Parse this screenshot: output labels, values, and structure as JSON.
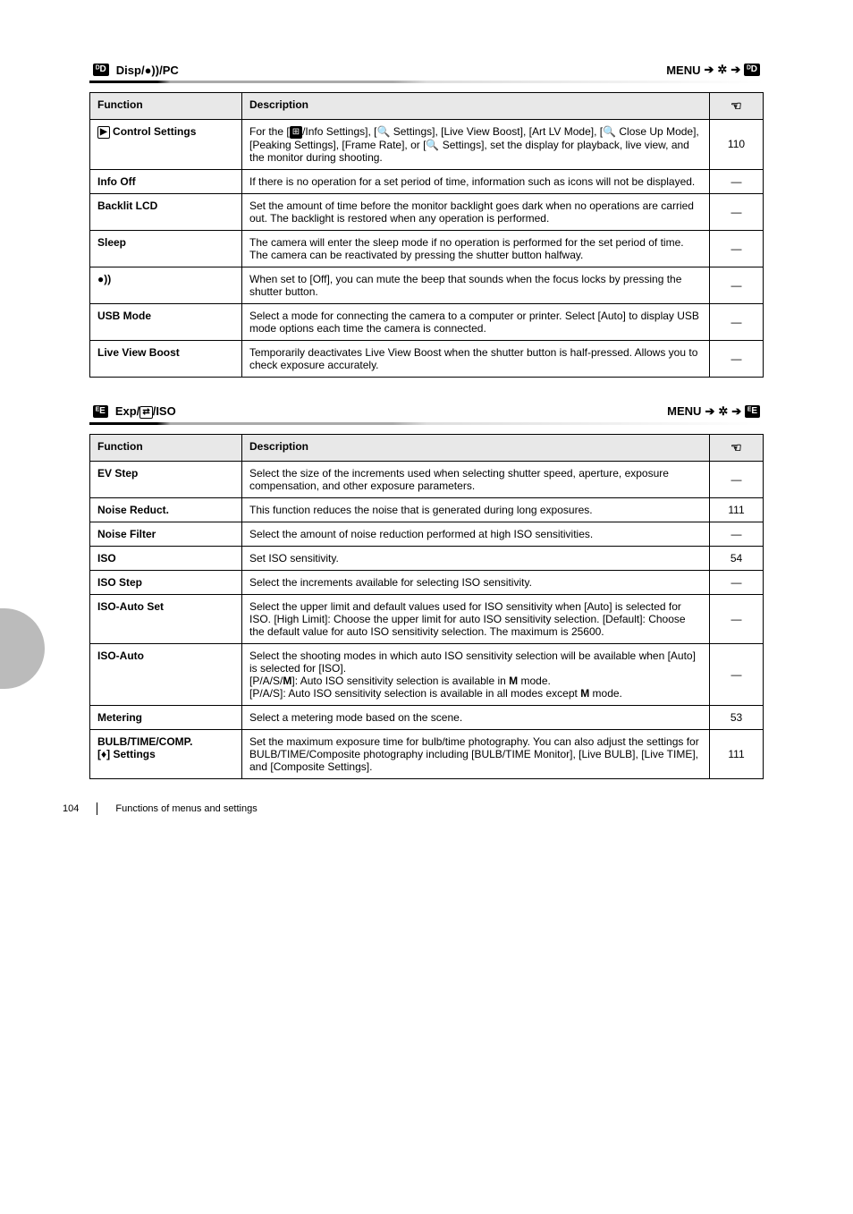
{
  "page": {
    "number": "104",
    "footer_text": "Functions of menus and settings"
  },
  "icons": {
    "tabD": "ᴰD",
    "tabE": "ᴱE",
    "beep": "●))",
    "arrow": "➔",
    "gear": "✲",
    "hand": "☞",
    "monitor_ctrl": "▶",
    "tile": "⊞",
    "zoom": "🔍",
    "exposure": "⇄",
    "manual": "M",
    "flash_bracket": "[♦]",
    "zoom_tiny": "🔍"
  },
  "sectionD": {
    "title": "Disp/   ))/PC",
    "path_label": "MENU",
    "table": {
      "header": {
        "function": "Function",
        "description": "Description",
        "ref": "Ref. Page"
      },
      "rows": [
        {
          "func_icon": "monitor_ctrl",
          "func": " Control Settings",
          "desc_lines": [
            "For the [​TILE​/Info Settings], [​ZOOM​ Settings], [Live View Boost],",
            "[Art LV Mode], [​ZOOM​ Close Up Mode], [Peaking Settings],",
            "[Frame Rate], or [​ZOOM_TINY​ Settings], set the display for",
            "playback, live view, and the monitor during shooting."
          ],
          "ref": "110"
        },
        {
          "func": "Info Off",
          "desc": "If there is no operation for a set period of time, information such as icons will not be displayed.",
          "ref": "—"
        },
        {
          "func": "Backlit LCD",
          "desc": "Set the amount of time before the monitor backlight goes dark when no operations are carried out. The backlight is restored when any operation is performed.",
          "ref": "—"
        },
        {
          "func": "Sleep",
          "desc": "The camera will enter the sleep mode if no operation is performed for the set period of time. The camera can be reactivated by pressing the shutter button halfway.",
          "ref": "—"
        },
        {
          "func_icon": "beep",
          "func": "",
          "desc": "When set to [Off], you can mute the beep that sounds when the focus locks by pressing the shutter button.",
          "ref": "—"
        },
        {
          "func": "USB Mode",
          "desc": "Select a mode for connecting the camera to a computer or printer. Select [Auto] to display USB mode options each time the camera is connected.",
          "ref": "—"
        },
        {
          "func": "Live View Boost",
          "desc": "Temporarily deactivates Live View Boost when the shutter button is half-pressed. Allows you to check exposure accurately.",
          "ref": "—"
        }
      ]
    }
  },
  "sectionE": {
    "title": "Exp/",
    "title_suffix": "/ISO",
    "path_label": "MENU",
    "table": {
      "header": {
        "function": "Function",
        "description": "Description",
        "ref": "Ref. Page"
      },
      "rows": [
        {
          "func": "EV Step",
          "desc": "Select the size of the increments used when selecting shutter speed, aperture, exposure compensation, and other exposure parameters.",
          "ref": "—"
        },
        {
          "func": "Noise Reduct.",
          "desc": "This function reduces the noise that is generated during long exposures.",
          "ref": "111"
        },
        {
          "func": "Noise Filter",
          "desc": "Select the amount of noise reduction performed at high ISO sensitivities.",
          "ref": "—"
        },
        {
          "func": "ISO",
          "desc": "Set ISO sensitivity.",
          "ref": "54"
        },
        {
          "func": "ISO Step",
          "desc": "Select the increments available for selecting ISO sensitivity.",
          "ref": "—"
        },
        {
          "func": "ISO-Auto Set",
          "desc": "Select the upper limit and default values used for ISO sensitivity when [Auto] is selected for ISO. [High Limit]: Choose the upper limit for auto ISO sensitivity selection. [Default]: Choose the default value for auto ISO sensitivity selection. The maximum is 25600.",
          "ref": "—"
        },
        {
          "func": "ISO-Auto",
          "desc_lines": [
            "Select the shooting modes in which auto ISO sensitivity selection will be available when [Auto] is selected for [ISO].",
            "[P/A/S/​M​]: Auto ISO sensitivity selection is available in ​M​ mode.",
            "[P/A/S]: Auto ISO sensitivity selection is available in all modes except ​M​ mode."
          ],
          "ref": "—"
        },
        {
          "func": "Metering",
          "desc": "Select a metering mode based on the scene.",
          "ref": "53"
        },
        {
          "func_icon": "flash_bracket",
          "func": "BULB/TIME/COMP. Settings",
          "desc": "Set the maximum exposure time for bulb/time photography. You can also adjust the settings for BULB/TIME/Composite photography including [BULB/TIME Monitor], [Live BULB], [Live TIME], and [Composite Settings].",
          "ref": "111"
        }
      ]
    }
  }
}
